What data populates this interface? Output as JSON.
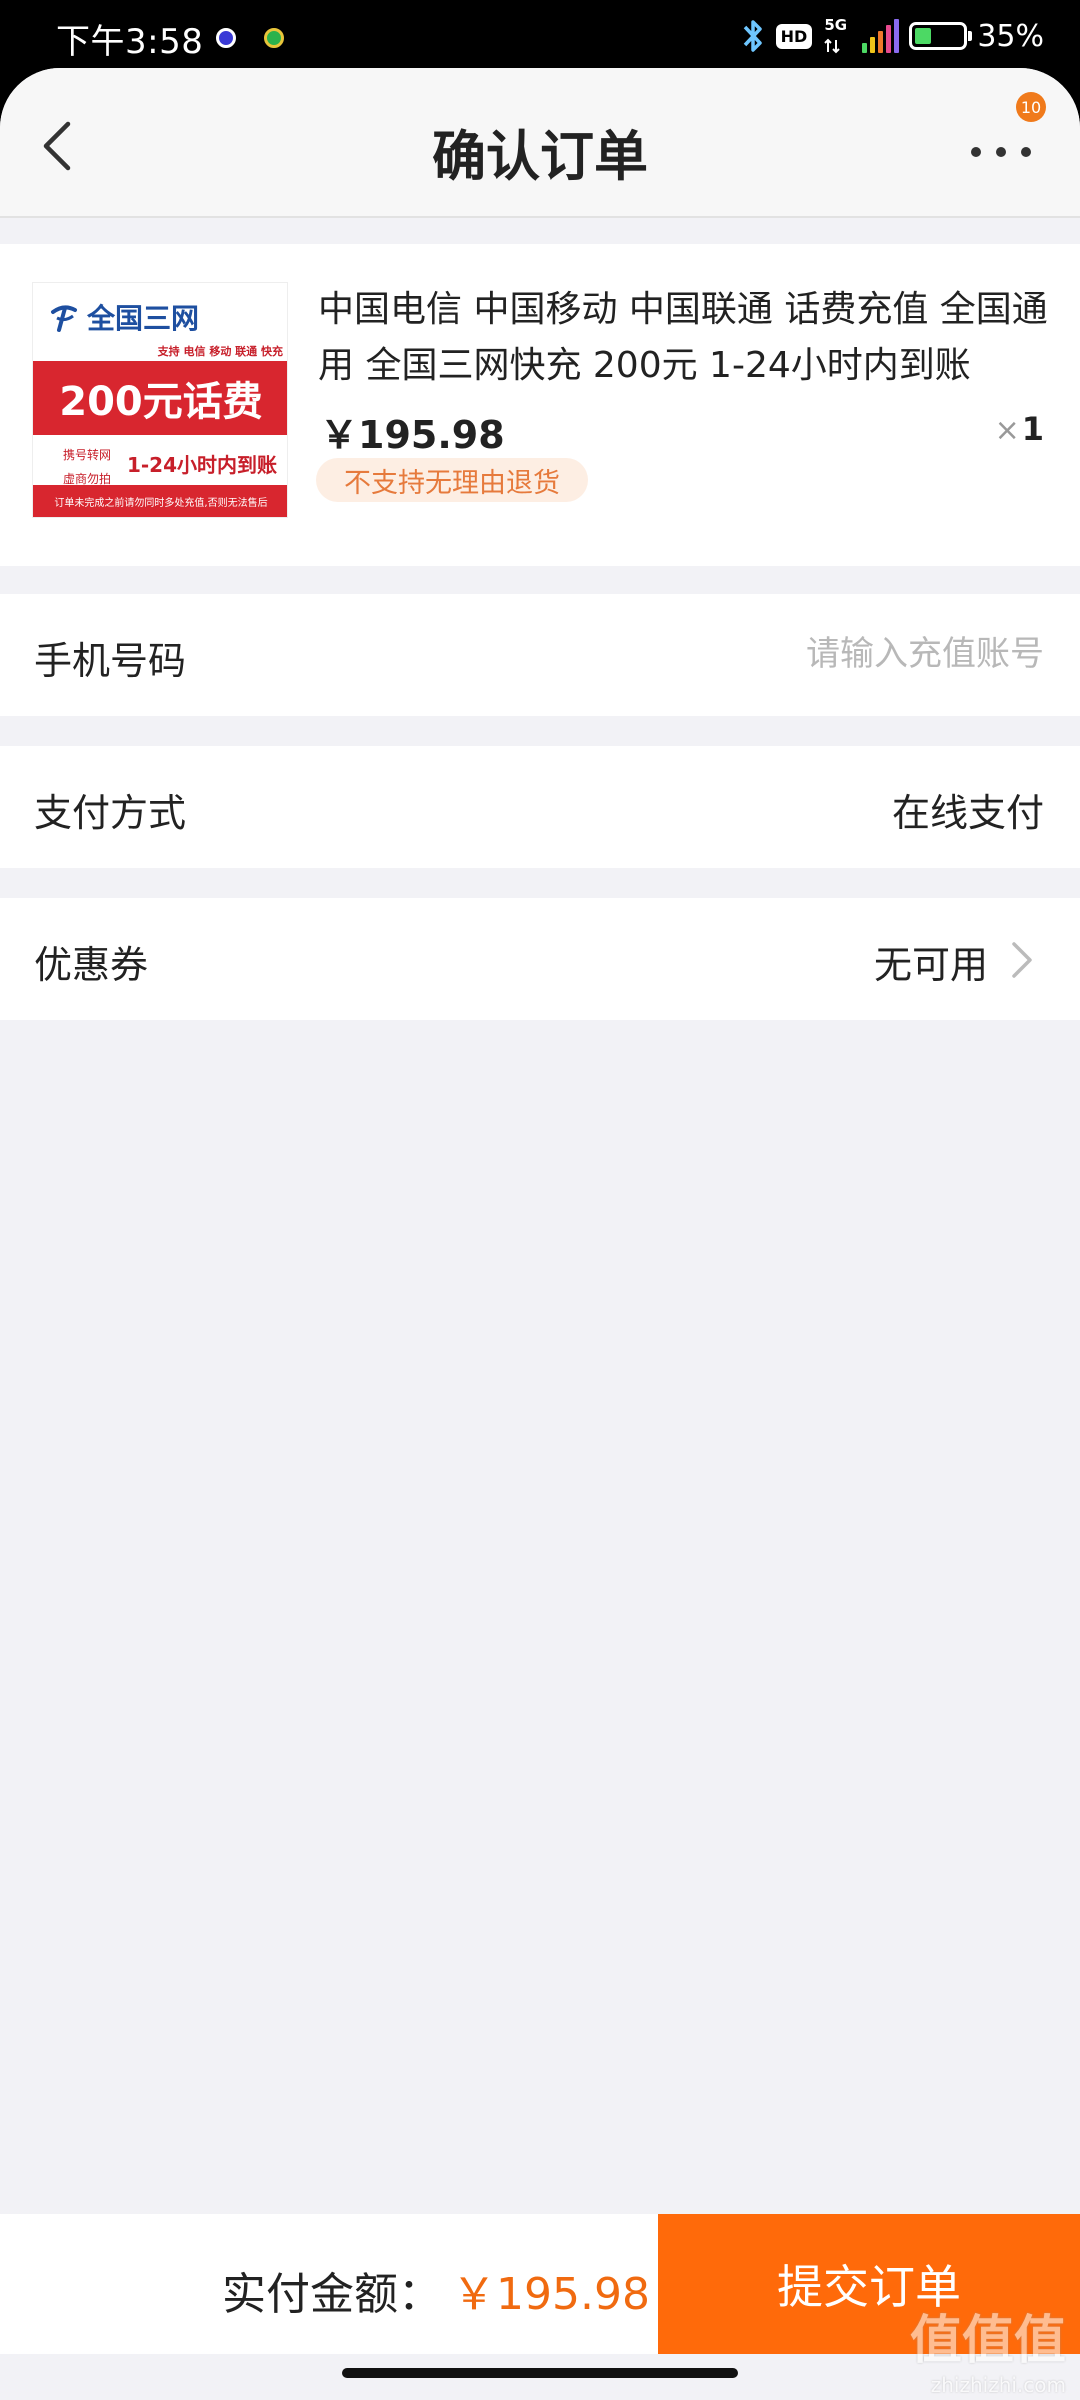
{
  "status_bar": {
    "time": "下午3:58",
    "hd": "HD",
    "network": "5G",
    "battery_level": 0.35,
    "battery_pct": "35%"
  },
  "nav": {
    "title": "确认订单",
    "more_badge": "10",
    "icons": [
      "back-icon",
      "more-icon"
    ]
  },
  "product": {
    "title": "中国电信 中国移动 中国联通 话费充值 全国通用 全国三网快充 200元 1-24小时内到账",
    "price": "￥195.98",
    "qty_symbol": "×",
    "qty": "1",
    "tag": "不支持无理由退货",
    "image": {
      "brand": "全国三网",
      "support": "支持 电信 移动 联通 快充",
      "band": "200元话费",
      "tag1": "携号转网",
      "tag2": "虚商勿拍",
      "time": "1-24小时内到账",
      "footer": "订单未完成之前请勿同时多处充值,否则无法售后"
    }
  },
  "rows": {
    "phone": {
      "label": "手机号码",
      "placeholder": "请输入充值账号",
      "value": ""
    },
    "payment": {
      "label": "支付方式",
      "value": "在线支付"
    },
    "coupon": {
      "label": "优惠券",
      "value": "无可用"
    }
  },
  "bottom": {
    "label": "实付金额：",
    "amount": "￥195.98",
    "submit": "提交订单"
  },
  "watermark": {
    "logo": "值值值",
    "site": "zhizhizhi.com"
  },
  "colors": {
    "accent": "#ff6a0a",
    "price_orange": "#f06a10",
    "tag_bg": "#fdeee3",
    "page_bg": "#f2f2f6"
  }
}
